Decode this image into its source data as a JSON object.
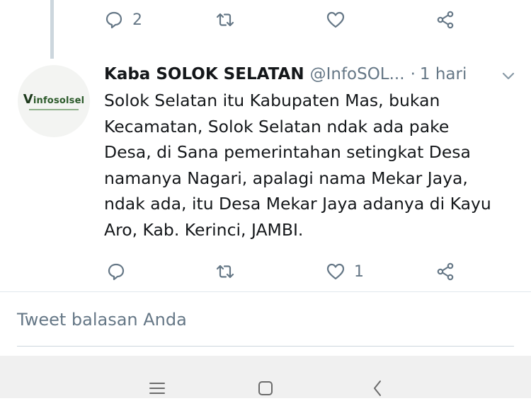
{
  "prev_tweet": {
    "reply_count": "2",
    "icons": [
      "reply-icon",
      "retweet-icon",
      "like-icon",
      "share-icon"
    ]
  },
  "tweet": {
    "avatar_logo_text": "infosolsel",
    "author_name": "Kaba SOLOK SELATAN",
    "handle": "@InfoSOL...",
    "separator": "·",
    "time": "1 hari",
    "lines": [
      "Solok Selatan itu Kabupaten Mas, bukan",
      "Kecamatan, Solok Selatan ndak ada pake",
      "Desa, di Sana pemerintahan setingkat Desa",
      "namanya Nagari, apalagi nama Mekar Jaya,",
      "ndak ada, itu Desa Mekar Jaya adanya di Kayu",
      "Aro, Kab. Kerinci, JAMBI."
    ],
    "like_count": "1"
  },
  "reply": {
    "placeholder": "Tweet balasan Anda"
  },
  "navbar": {
    "icons": [
      "recent-apps-icon",
      "home-icon",
      "back-icon"
    ]
  },
  "colors": {
    "secondary_text": "#657786",
    "thread_line": "#ccd6dd",
    "nav_background": "#f0f0f0"
  }
}
